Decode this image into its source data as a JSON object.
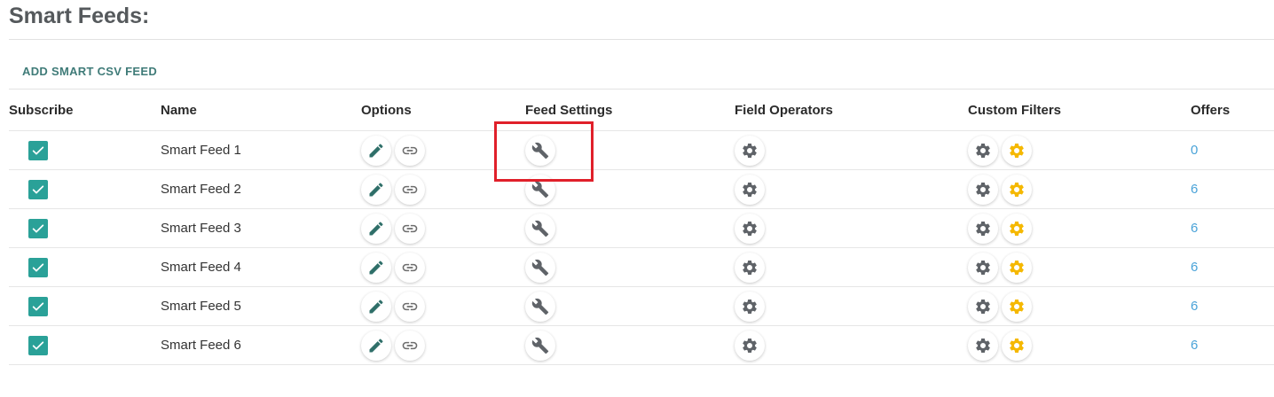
{
  "page": {
    "title": "Smart Feeds:"
  },
  "actions": {
    "add_label": "ADD SMART CSV FEED"
  },
  "table": {
    "headers": {
      "subscribe": "Subscribe",
      "name": "Name",
      "options": "Options",
      "feed_settings": "Feed Settings",
      "field_operators": "Field Operators",
      "custom_filters": "Custom Filters",
      "offers": "Offers"
    },
    "rows": [
      {
        "subscribed": true,
        "name": "Smart Feed 1",
        "offers": "0"
      },
      {
        "subscribed": true,
        "name": "Smart Feed 2",
        "offers": "6"
      },
      {
        "subscribed": true,
        "name": "Smart Feed 3",
        "offers": "6"
      },
      {
        "subscribed": true,
        "name": "Smart Feed 4",
        "offers": "6"
      },
      {
        "subscribed": true,
        "name": "Smart Feed 5",
        "offers": "6"
      },
      {
        "subscribed": true,
        "name": "Smart Feed 6",
        "offers": "6"
      }
    ]
  },
  "icons": {
    "checkbox": "checkbox-checked-icon",
    "edit": "pencil-icon",
    "link": "link-icon",
    "feed_settings": "wrench-icon",
    "field_operators": "gear-icon",
    "custom_filter_1": "gear-icon",
    "custom_filter_2": "gear-icon-yellow"
  },
  "colors": {
    "accent": "#2aa198",
    "link_text": "#3f7b78",
    "offers_link": "#4aa3d8",
    "edit_icon": "#2f6f69",
    "gear_grey": "#5f6368",
    "gear_yellow": "#f5b800",
    "highlight": "#e0202a"
  }
}
